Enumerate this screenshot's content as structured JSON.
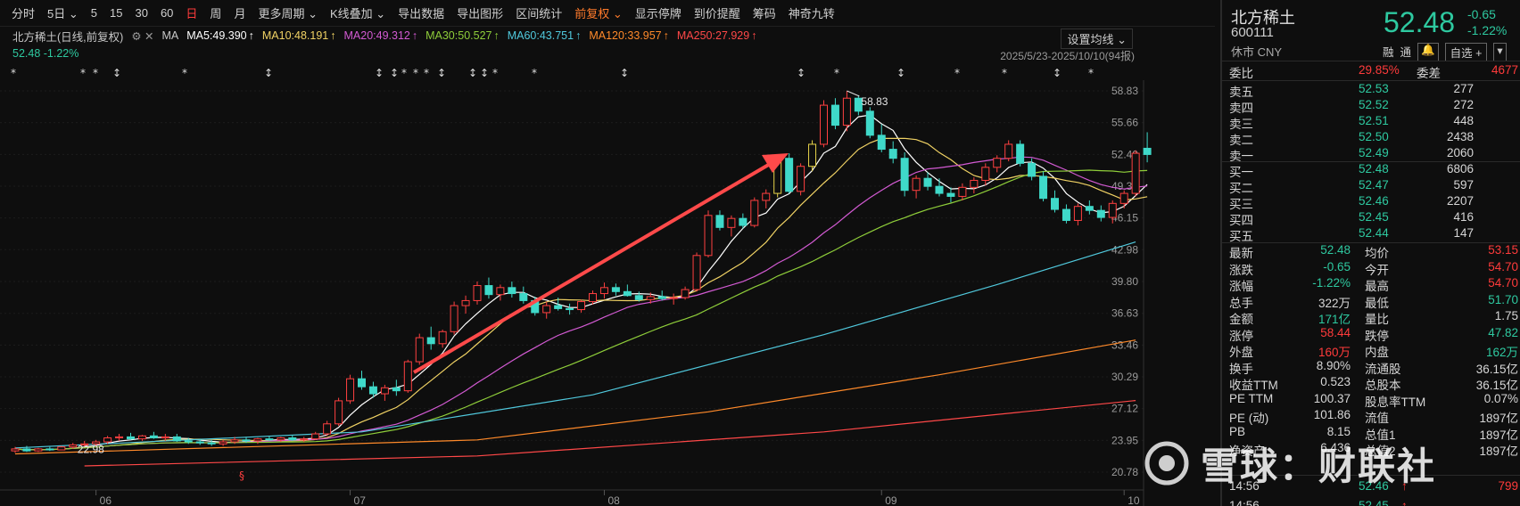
{
  "toolbar": {
    "items": [
      "分时",
      "5日 ⌄",
      "5",
      "15",
      "30",
      "60",
      "日",
      "周",
      "月",
      "更多周期 ⌄",
      "K线叠加 ⌄",
      "导出数据",
      "导出图形",
      "区间统计",
      "前复权 ⌄",
      "显示停牌",
      "到价提醒",
      "筹码",
      "神奇九转"
    ]
  },
  "chart_header": {
    "title": "北方稀土(日线,前复权)",
    "ma_prefix": "MA",
    "ma": [
      {
        "label": "MA5:49.390",
        "color": "#ffffff"
      },
      {
        "label": "MA10:48.191",
        "color": "#f0d264"
      },
      {
        "label": "MA20:49.312",
        "color": "#d25ad2"
      },
      {
        "label": "MA30:50.527",
        "color": "#8fce3a"
      },
      {
        "label": "MA60:43.751",
        "color": "#50c8dc"
      },
      {
        "label": "MA120:33.957",
        "color": "#ff8a2a"
      },
      {
        "label": "MA250:27.929",
        "color": "#ff4848"
      }
    ],
    "price_line": "52.48 -1.22%",
    "range": "2025/5/23-2025/10/10(94报)",
    "set_ma": "设置均线 ⌄"
  },
  "chart_data": {
    "type": "candlestick",
    "y_ticks": [
      "58.83",
      "55.66",
      "52.49",
      "49.32",
      "46.15",
      "42.98",
      "39.80",
      "36.63",
      "33.46",
      "30.29",
      "27.12",
      "23.95",
      "20.78"
    ],
    "x_labels": [
      "06",
      "07",
      "08",
      "09",
      "10"
    ],
    "high_label": "58.83",
    "low_label": "22.98",
    "candles": [
      [
        22.9,
        23.3,
        22.7,
        23.1
      ],
      [
        23.1,
        23.4,
        22.8,
        22.9
      ],
      [
        22.9,
        23.2,
        22.8,
        23.1
      ],
      [
        23.1,
        23.3,
        22.9,
        23.0
      ],
      [
        23.0,
        23.4,
        22.98,
        23.3
      ],
      [
        23.3,
        23.7,
        23.1,
        23.5
      ],
      [
        23.5,
        23.9,
        23.3,
        23.6
      ],
      [
        23.6,
        24.0,
        23.4,
        23.8
      ],
      [
        23.8,
        24.4,
        23.6,
        24.2
      ],
      [
        24.2,
        24.6,
        23.9,
        24.3
      ],
      [
        24.3,
        24.7,
        24.0,
        24.1
      ],
      [
        24.1,
        24.5,
        23.9,
        24.4
      ],
      [
        24.4,
        24.8,
        24.1,
        24.2
      ],
      [
        24.2,
        24.6,
        23.9,
        24.3
      ],
      [
        24.3,
        24.6,
        23.8,
        23.9
      ],
      [
        23.9,
        24.2,
        23.6,
        23.8
      ],
      [
        23.8,
        24.1,
        23.5,
        23.7
      ],
      [
        23.7,
        24.0,
        23.4,
        23.6
      ],
      [
        23.6,
        24.0,
        23.4,
        23.8
      ],
      [
        23.8,
        24.3,
        23.6,
        24.0
      ],
      [
        24.0,
        24.3,
        23.7,
        23.9
      ],
      [
        23.9,
        24.2,
        23.6,
        24.1
      ],
      [
        24.1,
        24.4,
        23.9,
        24.0
      ],
      [
        24.0,
        24.3,
        23.8,
        24.2
      ],
      [
        24.2,
        24.5,
        23.9,
        24.0
      ],
      [
        24.0,
        24.3,
        23.8,
        24.1
      ],
      [
        24.1,
        24.8,
        24.0,
        24.6
      ],
      [
        24.6,
        25.9,
        24.4,
        25.6
      ],
      [
        25.6,
        28.2,
        25.4,
        27.9
      ],
      [
        27.9,
        30.5,
        27.6,
        30.1
      ],
      [
        30.1,
        30.9,
        29.0,
        29.3
      ],
      [
        29.3,
        29.8,
        28.2,
        28.6
      ],
      [
        28.6,
        29.5,
        27.9,
        29.2
      ],
      [
        29.2,
        30.0,
        28.4,
        28.9
      ],
      [
        28.9,
        32.0,
        28.7,
        31.8
      ],
      [
        31.8,
        34.6,
        31.5,
        34.2
      ],
      [
        34.2,
        35.3,
        33.0,
        33.6
      ],
      [
        33.6,
        35.0,
        33.2,
        34.8
      ],
      [
        34.8,
        37.8,
        34.5,
        37.4
      ],
      [
        37.4,
        38.4,
        36.6,
        37.9
      ],
      [
        37.9,
        39.8,
        37.5,
        39.4
      ],
      [
        39.4,
        40.2,
        38.1,
        38.5
      ],
      [
        38.5,
        39.5,
        37.9,
        39.2
      ],
      [
        39.2,
        39.8,
        38.2,
        38.6
      ],
      [
        38.6,
        39.3,
        37.6,
        37.9
      ],
      [
        37.9,
        38.3,
        36.4,
        36.7
      ],
      [
        36.7,
        37.8,
        36.1,
        37.4
      ],
      [
        37.4,
        38.2,
        36.9,
        37.1
      ],
      [
        37.1,
        37.6,
        36.5,
        37.0
      ],
      [
        37.0,
        38.0,
        36.7,
        37.8
      ],
      [
        37.8,
        38.9,
        37.5,
        38.6
      ],
      [
        38.6,
        39.7,
        38.1,
        39.2
      ],
      [
        39.2,
        39.6,
        38.4,
        38.8
      ],
      [
        38.8,
        39.5,
        38.3,
        38.4
      ],
      [
        38.4,
        38.8,
        37.8,
        38.0
      ],
      [
        38.0,
        38.7,
        37.6,
        38.3
      ],
      [
        38.3,
        38.9,
        37.9,
        38.1
      ],
      [
        38.1,
        38.6,
        37.5,
        38.2
      ],
      [
        38.2,
        39.3,
        38.0,
        39.0
      ],
      [
        39.0,
        42.7,
        38.8,
        42.4
      ],
      [
        42.4,
        46.9,
        42.2,
        46.4
      ],
      [
        46.4,
        46.9,
        44.9,
        45.2
      ],
      [
        45.2,
        46.4,
        44.3,
        46.1
      ],
      [
        46.1,
        46.6,
        45.1,
        45.4
      ],
      [
        45.4,
        48.2,
        45.2,
        47.9
      ],
      [
        47.9,
        49.0,
        47.1,
        48.6
      ],
      [
        48.6,
        52.4,
        48.2,
        52.1
      ],
      [
        52.1,
        52.6,
        48.6,
        48.8
      ],
      [
        48.8,
        51.6,
        48.4,
        51.3
      ],
      [
        51.3,
        53.9,
        50.8,
        53.5
      ],
      [
        53.5,
        57.9,
        53.2,
        57.4
      ],
      [
        57.4,
        58.1,
        55.0,
        55.4
      ],
      [
        55.4,
        58.83,
        54.8,
        58.1
      ],
      [
        58.1,
        58.4,
        56.4,
        56.8
      ],
      [
        56.8,
        57.2,
        54.1,
        54.4
      ],
      [
        54.4,
        55.5,
        52.7,
        53.0
      ],
      [
        53.0,
        53.8,
        51.6,
        52.1
      ],
      [
        52.1,
        52.7,
        48.3,
        48.9
      ],
      [
        48.9,
        50.4,
        48.1,
        50.1
      ],
      [
        50.1,
        50.7,
        48.9,
        49.3
      ],
      [
        49.3,
        50.1,
        48.3,
        48.6
      ],
      [
        48.6,
        49.2,
        47.7,
        48.3
      ],
      [
        48.3,
        49.6,
        47.9,
        49.2
      ],
      [
        49.2,
        50.2,
        48.6,
        49.9
      ],
      [
        49.9,
        51.6,
        49.4,
        51.2
      ],
      [
        51.2,
        52.4,
        50.7,
        52.1
      ],
      [
        52.1,
        53.9,
        51.8,
        53.5
      ],
      [
        53.5,
        53.9,
        51.3,
        51.6
      ],
      [
        51.6,
        52.1,
        49.9,
        50.3
      ],
      [
        50.3,
        50.8,
        47.8,
        48.1
      ],
      [
        48.1,
        48.9,
        46.7,
        47.0
      ],
      [
        47.0,
        47.5,
        45.6,
        45.9
      ],
      [
        45.9,
        47.6,
        45.4,
        47.3
      ],
      [
        47.3,
        47.9,
        46.5,
        46.9
      ],
      [
        46.9,
        47.4,
        45.8,
        46.2
      ],
      [
        46.2,
        47.9,
        45.6,
        47.6
      ],
      [
        47.6,
        48.9,
        47.1,
        48.6
      ],
      [
        48.6,
        52.9,
        48.3,
        52.6
      ],
      [
        53.1,
        54.7,
        51.7,
        52.48
      ]
    ]
  },
  "quote": {
    "name": "北方稀土",
    "code": "600111",
    "status": "休市 CNY",
    "price": "52.48",
    "change": "-0.65",
    "pct": "-1.22%",
    "tabs": [
      "融",
      "通",
      "自选 +"
    ],
    "weibi": {
      "label": "委比",
      "value": "29.85%",
      "label2": "委差",
      "value2": "4677"
    },
    "asks": [
      {
        "l": "卖五",
        "p": "52.53",
        "v": "277"
      },
      {
        "l": "卖四",
        "p": "52.52",
        "v": "272"
      },
      {
        "l": "卖三",
        "p": "52.51",
        "v": "448"
      },
      {
        "l": "卖二",
        "p": "52.50",
        "v": "2438"
      },
      {
        "l": "卖一",
        "p": "52.49",
        "v": "2060"
      }
    ],
    "bids": [
      {
        "l": "买一",
        "p": "52.48",
        "v": "6806"
      },
      {
        "l": "买二",
        "p": "52.47",
        "v": "597"
      },
      {
        "l": "买三",
        "p": "52.46",
        "v": "2207"
      },
      {
        "l": "买四",
        "p": "52.45",
        "v": "416"
      },
      {
        "l": "买五",
        "p": "52.44",
        "v": "147"
      }
    ],
    "stats": [
      {
        "l1": "最新",
        "v1": "52.48",
        "c1": "dn",
        "l2": "均价",
        "v2": "53.15",
        "c2": "up"
      },
      {
        "l1": "涨跌",
        "v1": "-0.65",
        "c1": "dn",
        "l2": "今开",
        "v2": "54.70",
        "c2": "up"
      },
      {
        "l1": "涨幅",
        "v1": "-1.22%",
        "c1": "dn",
        "l2": "最高",
        "v2": "54.70",
        "c2": "up"
      },
      {
        "l1": "总手",
        "v1": "322万",
        "c1": "wh",
        "l2": "最低",
        "v2": "51.70",
        "c2": "dn"
      },
      {
        "l1": "金额",
        "v1": "171亿",
        "c1": "dn",
        "l2": "量比",
        "v2": "1.75",
        "c2": "wh"
      },
      {
        "l1": "涨停",
        "v1": "58.44",
        "c1": "up",
        "l2": "跌停",
        "v2": "47.82",
        "c2": "dn"
      },
      {
        "l1": "外盘",
        "v1": "160万",
        "c1": "up",
        "l2": "内盘",
        "v2": "162万",
        "c2": "dn"
      },
      {
        "l1": "换手",
        "v1": "8.90%",
        "c1": "wh",
        "l2": "流通股",
        "v2": "36.15亿",
        "c2": "wh"
      },
      {
        "l1": "收益TTM",
        "v1": "0.523",
        "c1": "wh",
        "l2": "总股本",
        "v2": "36.15亿",
        "c2": "wh"
      },
      {
        "l1": "PE TTM",
        "v1": "100.37",
        "c1": "wh",
        "l2": "股息率TTM",
        "v2": "0.07%",
        "c2": "wh"
      },
      {
        "l1": "PE (动)",
        "v1": "101.86",
        "c1": "wh",
        "l2": "流值",
        "v2": "1897亿",
        "c2": "wh"
      },
      {
        "l1": "PB",
        "v1": "8.15",
        "c1": "wh",
        "l2": "总值1",
        "v2": "1897亿",
        "c2": "wh"
      },
      {
        "l1": "净资产",
        "v1": "6.436",
        "c1": "wh",
        "l2": "总值2",
        "v2": "1897亿",
        "c2": "wh"
      }
    ],
    "tick": [
      {
        "time": "14:56",
        "price": "52.46",
        "arrow": "↑",
        "vol": "799"
      },
      {
        "time": "14:56",
        "price": "52.45",
        "arrow": "↑",
        "vol": "..."
      }
    ]
  },
  "watermark": "雪球：财联社"
}
